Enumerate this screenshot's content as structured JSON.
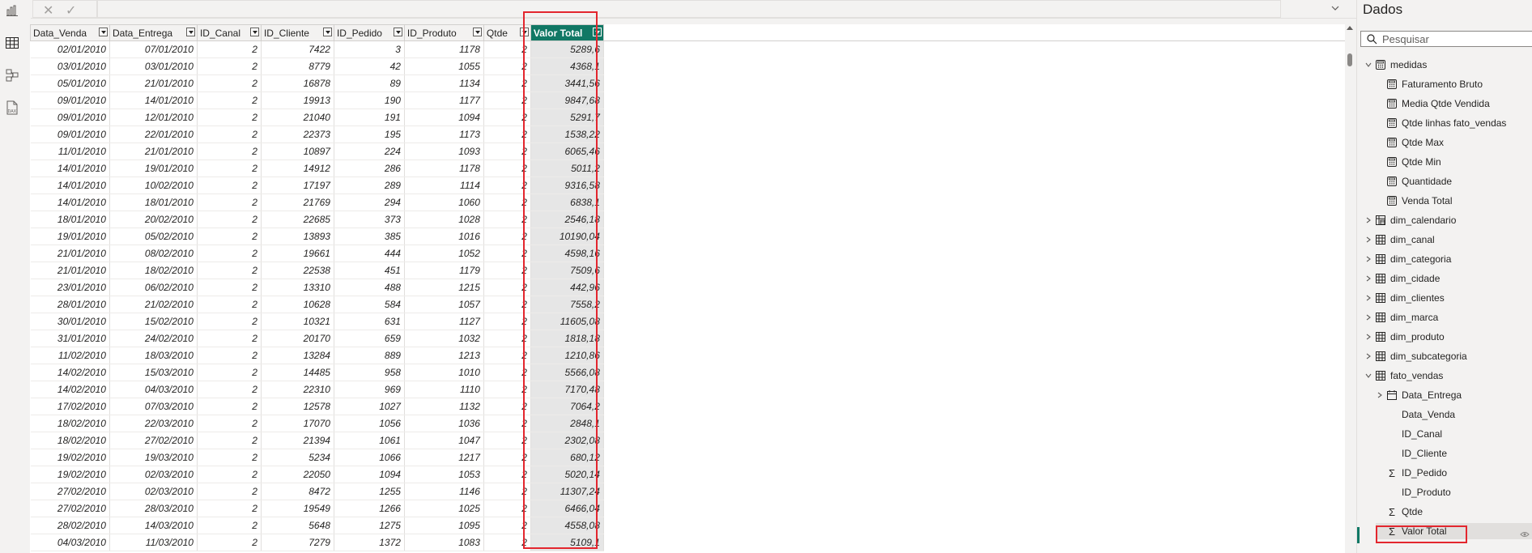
{
  "formula_bar": {
    "cancel_glyph": "✕",
    "commit_glyph": "✓"
  },
  "table": {
    "columns": [
      "Data_Venda",
      "Data_Entrega",
      "ID_Canal",
      "ID_Cliente",
      "ID_Pedido",
      "ID_Produto",
      "Qtde",
      "Valor Total"
    ],
    "selected_column": "Valor Total",
    "rows": [
      [
        "02/01/2010",
        "07/01/2010",
        "2",
        "7422",
        "3",
        "1178",
        "2",
        "5289,6"
      ],
      [
        "03/01/2010",
        "03/01/2010",
        "2",
        "8779",
        "42",
        "1055",
        "2",
        "4368,1"
      ],
      [
        "05/01/2010",
        "21/01/2010",
        "2",
        "16878",
        "89",
        "1134",
        "2",
        "3441,56"
      ],
      [
        "09/01/2010",
        "14/01/2010",
        "2",
        "19913",
        "190",
        "1177",
        "2",
        "9847,68"
      ],
      [
        "09/01/2010",
        "12/01/2010",
        "2",
        "21040",
        "191",
        "1094",
        "2",
        "5291,7"
      ],
      [
        "09/01/2010",
        "22/01/2010",
        "2",
        "22373",
        "195",
        "1173",
        "2",
        "1538,22"
      ],
      [
        "11/01/2010",
        "21/01/2010",
        "2",
        "10897",
        "224",
        "1093",
        "2",
        "6065,46"
      ],
      [
        "14/01/2010",
        "19/01/2010",
        "2",
        "14912",
        "286",
        "1178",
        "2",
        "5011,2"
      ],
      [
        "14/01/2010",
        "10/02/2010",
        "2",
        "17197",
        "289",
        "1114",
        "2",
        "9316,58"
      ],
      [
        "14/01/2010",
        "18/01/2010",
        "2",
        "21769",
        "294",
        "1060",
        "2",
        "6838,1"
      ],
      [
        "18/01/2010",
        "20/02/2010",
        "2",
        "22685",
        "373",
        "1028",
        "2",
        "2546,18"
      ],
      [
        "19/01/2010",
        "05/02/2010",
        "2",
        "13893",
        "385",
        "1016",
        "2",
        "10190,04"
      ],
      [
        "21/01/2010",
        "08/02/2010",
        "2",
        "19661",
        "444",
        "1052",
        "2",
        "4598,16"
      ],
      [
        "21/01/2010",
        "18/02/2010",
        "2",
        "22538",
        "451",
        "1179",
        "2",
        "7509,6"
      ],
      [
        "23/01/2010",
        "06/02/2010",
        "2",
        "13310",
        "488",
        "1215",
        "2",
        "442,96"
      ],
      [
        "28/01/2010",
        "21/02/2010",
        "2",
        "10628",
        "584",
        "1057",
        "2",
        "7558,2"
      ],
      [
        "30/01/2010",
        "15/02/2010",
        "2",
        "10321",
        "631",
        "1127",
        "2",
        "11605,08"
      ],
      [
        "31/01/2010",
        "24/02/2010",
        "2",
        "20170",
        "659",
        "1032",
        "2",
        "1818,18"
      ],
      [
        "11/02/2010",
        "18/03/2010",
        "2",
        "13284",
        "889",
        "1213",
        "2",
        "1210,86"
      ],
      [
        "14/02/2010",
        "15/03/2010",
        "2",
        "14485",
        "958",
        "1010",
        "2",
        "5566,08"
      ],
      [
        "14/02/2010",
        "04/03/2010",
        "2",
        "22310",
        "969",
        "1110",
        "2",
        "7170,48"
      ],
      [
        "17/02/2010",
        "07/03/2010",
        "2",
        "12578",
        "1027",
        "1132",
        "2",
        "7064,2"
      ],
      [
        "18/02/2010",
        "22/03/2010",
        "2",
        "17070",
        "1056",
        "1036",
        "2",
        "2848,1"
      ],
      [
        "18/02/2010",
        "27/02/2010",
        "2",
        "21394",
        "1061",
        "1047",
        "2",
        "2302,08"
      ],
      [
        "19/02/2010",
        "19/03/2010",
        "2",
        "5234",
        "1066",
        "1217",
        "2",
        "680,12"
      ],
      [
        "19/02/2010",
        "02/03/2010",
        "2",
        "22050",
        "1094",
        "1053",
        "2",
        "5020,14"
      ],
      [
        "27/02/2010",
        "02/03/2010",
        "2",
        "8472",
        "1255",
        "1146",
        "2",
        "11307,24"
      ],
      [
        "27/02/2010",
        "28/03/2010",
        "2",
        "19549",
        "1266",
        "1025",
        "2",
        "6466,04"
      ],
      [
        "28/02/2010",
        "14/03/2010",
        "2",
        "5648",
        "1275",
        "1095",
        "2",
        "4558,08"
      ],
      [
        "04/03/2010",
        "11/03/2010",
        "2",
        "7279",
        "1372",
        "1083",
        "2",
        "5109,1"
      ]
    ]
  },
  "pane": {
    "title": "Dados",
    "search_placeholder": "Pesquisar",
    "tree": [
      {
        "label": "medidas",
        "kind": "measure-table",
        "level": 0,
        "expanded": true
      },
      {
        "label": "Faturamento Bruto",
        "kind": "measure",
        "level": 1
      },
      {
        "label": "Media Qtde Vendida",
        "kind": "measure",
        "level": 1
      },
      {
        "label": "Qtde linhas fato_vendas",
        "kind": "measure",
        "level": 1
      },
      {
        "label": "Qtde Max",
        "kind": "measure",
        "level": 1
      },
      {
        "label": "Qtde Min",
        "kind": "measure",
        "level": 1
      },
      {
        "label": "Quantidade",
        "kind": "measure",
        "level": 1
      },
      {
        "label": "Venda Total",
        "kind": "measure",
        "level": 1
      },
      {
        "label": "dim_calendario",
        "kind": "calendar-table",
        "level": 0,
        "expanded": false
      },
      {
        "label": "dim_canal",
        "kind": "table",
        "level": 0,
        "expanded": false
      },
      {
        "label": "dim_categoria",
        "kind": "table",
        "level": 0,
        "expanded": false
      },
      {
        "label": "dim_cidade",
        "kind": "table",
        "level": 0,
        "expanded": false
      },
      {
        "label": "dim_clientes",
        "kind": "table",
        "level": 0,
        "expanded": false
      },
      {
        "label": "dim_marca",
        "kind": "table",
        "level": 0,
        "expanded": false
      },
      {
        "label": "dim_produto",
        "kind": "table",
        "level": 0,
        "expanded": false
      },
      {
        "label": "dim_subcategoria",
        "kind": "table",
        "level": 0,
        "expanded": false
      },
      {
        "label": "fato_vendas",
        "kind": "table",
        "level": 0,
        "expanded": true
      },
      {
        "label": "Data_Entrega",
        "kind": "date-hierarchy",
        "level": 1,
        "expanded": false
      },
      {
        "label": "Data_Venda",
        "kind": "field",
        "level": 1
      },
      {
        "label": "ID_Canal",
        "kind": "field",
        "level": 1
      },
      {
        "label": "ID_Cliente",
        "kind": "field",
        "level": 1
      },
      {
        "label": "ID_Pedido",
        "kind": "sum-field",
        "level": 1
      },
      {
        "label": "ID_Produto",
        "kind": "field",
        "level": 1
      },
      {
        "label": "Qtde",
        "kind": "sum-field",
        "level": 1
      },
      {
        "label": "Valor Total",
        "kind": "sum-field",
        "level": 1,
        "active": true
      }
    ]
  },
  "colors": {
    "accent": "#117865",
    "highlight": "#e3262e"
  }
}
